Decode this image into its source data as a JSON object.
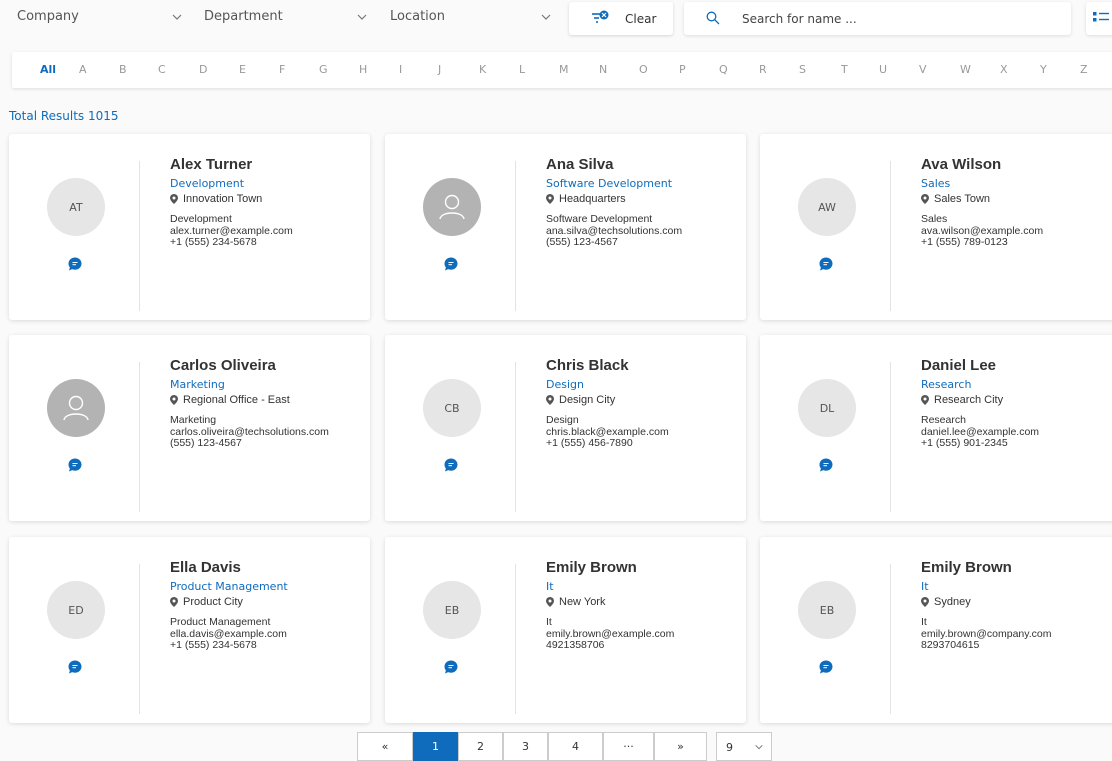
{
  "filters": {
    "company_label": "Company",
    "department_label": "Department",
    "location_label": "Location",
    "clear_label": "Clear",
    "search_placeholder": "Search for name ..."
  },
  "alphabet": [
    "All",
    "A",
    "B",
    "C",
    "D",
    "E",
    "F",
    "G",
    "H",
    "I",
    "J",
    "K",
    "L",
    "M",
    "N",
    "O",
    "P",
    "Q",
    "R",
    "S",
    "T",
    "U",
    "V",
    "W",
    "X",
    "Y",
    "Z"
  ],
  "total_results": "Total Results 1015",
  "employees": [
    {
      "initials": "AT",
      "name": "Alex Turner",
      "department": "Development",
      "location": "Innovation Town",
      "detail_dept": "Development",
      "email": "alex.turner@example.com",
      "phone": "+1 (555) 234-5678",
      "photo": false
    },
    {
      "initials": "",
      "name": "Ana Silva",
      "department": "Software Development",
      "location": "Headquarters",
      "detail_dept": "Software Development",
      "email": "ana.silva@techsolutions.com",
      "phone": "(555) 123-4567",
      "photo": true
    },
    {
      "initials": "AW",
      "name": "Ava Wilson",
      "department": "Sales",
      "location": "Sales Town",
      "detail_dept": "Sales",
      "email": "ava.wilson@example.com",
      "phone": "+1 (555) 789-0123",
      "photo": false
    },
    {
      "initials": "",
      "name": "Carlos Oliveira",
      "department": "Marketing",
      "location": "Regional Office - East",
      "detail_dept": "Marketing",
      "email": "carlos.oliveira@techsolutions.com",
      "phone": "(555) 123-4567",
      "photo": true
    },
    {
      "initials": "CB",
      "name": "Chris Black",
      "department": "Design",
      "location": "Design City",
      "detail_dept": "Design",
      "email": "chris.black@example.com",
      "phone": "+1 (555) 456-7890",
      "photo": false
    },
    {
      "initials": "DL",
      "name": "Daniel Lee",
      "department": "Research",
      "location": "Research City",
      "detail_dept": "Research",
      "email": "daniel.lee@example.com",
      "phone": "+1 (555) 901-2345",
      "photo": false
    },
    {
      "initials": "ED",
      "name": "Ella Davis",
      "department": "Product Management",
      "location": "Product City",
      "detail_dept": "Product Management",
      "email": "ella.davis@example.com",
      "phone": "+1 (555) 234-5678",
      "photo": false
    },
    {
      "initials": "EB",
      "name": "Emily Brown",
      "department": "It",
      "location": "New York",
      "detail_dept": "It",
      "email": "emily.brown@example.com",
      "phone": "4921358706",
      "photo": false
    },
    {
      "initials": "EB",
      "name": "Emily Brown",
      "department": "It",
      "location": "Sydney",
      "detail_dept": "It",
      "email": "emily.brown@company.com",
      "phone": "8293704615",
      "photo": false
    }
  ],
  "pagination": {
    "first": "«",
    "pages": [
      "1",
      "2",
      "3",
      "4"
    ],
    "ellipsis": "···",
    "next": "»",
    "page_size": "9"
  },
  "colors": {
    "accent": "#0f6cbd",
    "avatar_bg": "#e6e6e6",
    "photo_bg": "#b3b3b3"
  },
  "icons": [
    "chevron-down-icon",
    "filter-clear-icon",
    "search-icon",
    "list-view-icon",
    "location-pin-icon",
    "chat-icon",
    "user-placeholder-icon"
  ]
}
